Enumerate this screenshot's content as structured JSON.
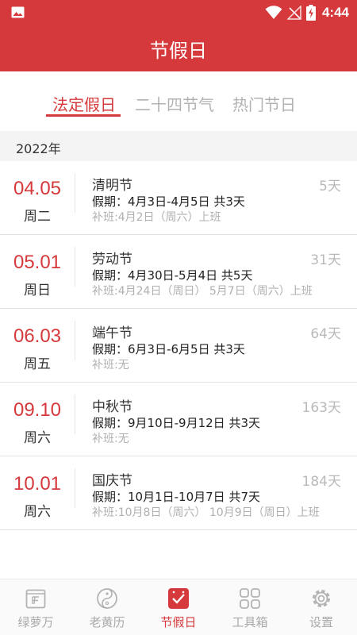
{
  "status_bar": {
    "time": "4:44",
    "icons": [
      "image-icon",
      "wifi-icon",
      "no-signal-icon",
      "battery-charging-icon"
    ]
  },
  "app_bar": {
    "title": "节假日"
  },
  "tabs": [
    {
      "label": "法定假日",
      "active": true
    },
    {
      "label": "二十四节气",
      "active": false
    },
    {
      "label": "热门节日",
      "active": false
    }
  ],
  "year_header": "2022年",
  "holidays": [
    {
      "date": "04.05",
      "weekday": "周二",
      "name": "清明节",
      "period": "假期：4月3日-4月5日 共3天",
      "makeup": "补班:4月2日（周六）上班",
      "days_left": "5天"
    },
    {
      "date": "05.01",
      "weekday": "周日",
      "name": "劳动节",
      "period": "假期：4月30日-5月4日 共5天",
      "makeup": "补班:4月24日（周日） 5月7日（周六）上班",
      "days_left": "31天"
    },
    {
      "date": "06.03",
      "weekday": "周五",
      "name": "端午节",
      "period": "假期：6月3日-6月5日 共3天",
      "makeup": "补班:无",
      "days_left": "64天"
    },
    {
      "date": "09.10",
      "weekday": "周六",
      "name": "中秋节",
      "period": "假期：9月10日-9月12日 共3天",
      "makeup": "补班:无",
      "days_left": "163天"
    },
    {
      "date": "10.01",
      "weekday": "周六",
      "name": "国庆节",
      "period": "假期：10月1日-10月7日 共7天",
      "makeup": "补班:10月8日（周六） 10月9日（周日）上班",
      "days_left": "184天"
    }
  ],
  "bottom_nav": [
    {
      "label": "绿萝万",
      "icon": "calendar-book-icon",
      "active": false
    },
    {
      "label": "老黄历",
      "icon": "yin-yang-icon",
      "active": false
    },
    {
      "label": "节假日",
      "icon": "holiday-check-icon",
      "active": true
    },
    {
      "label": "工具箱",
      "icon": "grid-icon",
      "active": false
    },
    {
      "label": "设置",
      "icon": "gear-icon",
      "active": false
    }
  ],
  "colors": {
    "accent": "#d5393b",
    "muted": "#b3b3b3",
    "text": "#333333"
  }
}
